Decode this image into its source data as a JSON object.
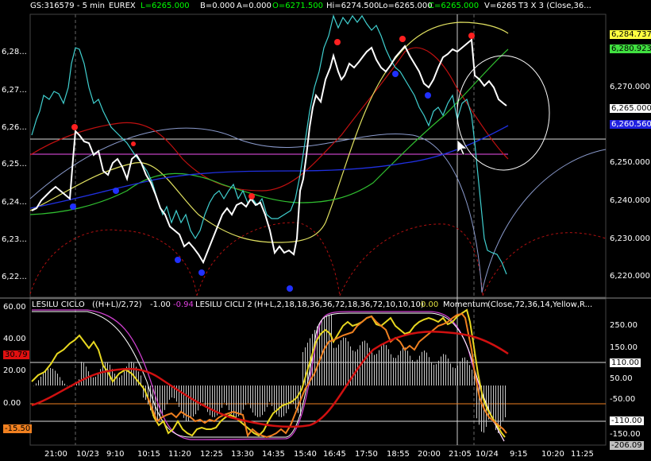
{
  "header": {
    "symbol": "GS:316579 - 5 min",
    "exchange": "EUREX",
    "last": "L=6265.000",
    "bid": "B=0.000",
    "ask": "A=0.000",
    "open": "O=6271.500",
    "high": "Hi=6274.500",
    "low": "Lo=6265.000",
    "close": "C=6265.000",
    "vol": "V=6265",
    "study": "T3 X 3 (Close,36..."
  },
  "price_axis": {
    "ticks": [
      "6,28...",
      "6,27...",
      "6,26...",
      "6,25...",
      "6,24...",
      "6,23...",
      "6,22..."
    ],
    "right_ticks": [
      "6,270.000",
      "6,250.000",
      "6,240.000",
      "6,230.000",
      "6,220.000"
    ],
    "badges": {
      "yellow": "6,284.737",
      "green": "6,280.923",
      "white": "6,265.000",
      "blue": "6,260.560"
    }
  },
  "indicator_header": {
    "name1": "LESILU CICLO",
    "params1": "((H+L)/2,72)",
    "val1": "-1.00",
    "val2": "-0.94",
    "name2": "LESILU CICLI 2",
    "params2": "(H+L,2,18,18,36,36,72,18,36,72,10,10,10)",
    "val3": "0.00",
    "name3": "Momentum",
    "params3": "(Close,72,36,14,Yellow,R..."
  },
  "lower_axis": {
    "left_ticks": [
      "60.00",
      "40.00",
      "20.00",
      "0.00"
    ],
    "left_badges": {
      "red": "30.79",
      "orange": "-15.50"
    },
    "right_ticks": [
      "250.00",
      "150.00",
      "50.00",
      "-50.00",
      "-150.00"
    ],
    "right_badges": {
      "white1": "110.00",
      "white2": "-110.00",
      "gray": "-206.09"
    }
  },
  "time_axis": [
    "21:00",
    "10/23",
    "9:10",
    "10:15",
    "11:20",
    "12:25",
    "13:30",
    "14:35",
    "15:40",
    "16:45",
    "17:50",
    "18:55",
    "20:00",
    "21:05",
    "10/24",
    "9:15",
    "10:20",
    "11:25"
  ],
  "colors": {
    "cyan": "#40d0d0",
    "red": "#d01010",
    "yellow": "#e8e860",
    "green": "#30c030",
    "blue": "#2020e0",
    "magenta": "#d040d0",
    "orange": "#f08020"
  }
}
